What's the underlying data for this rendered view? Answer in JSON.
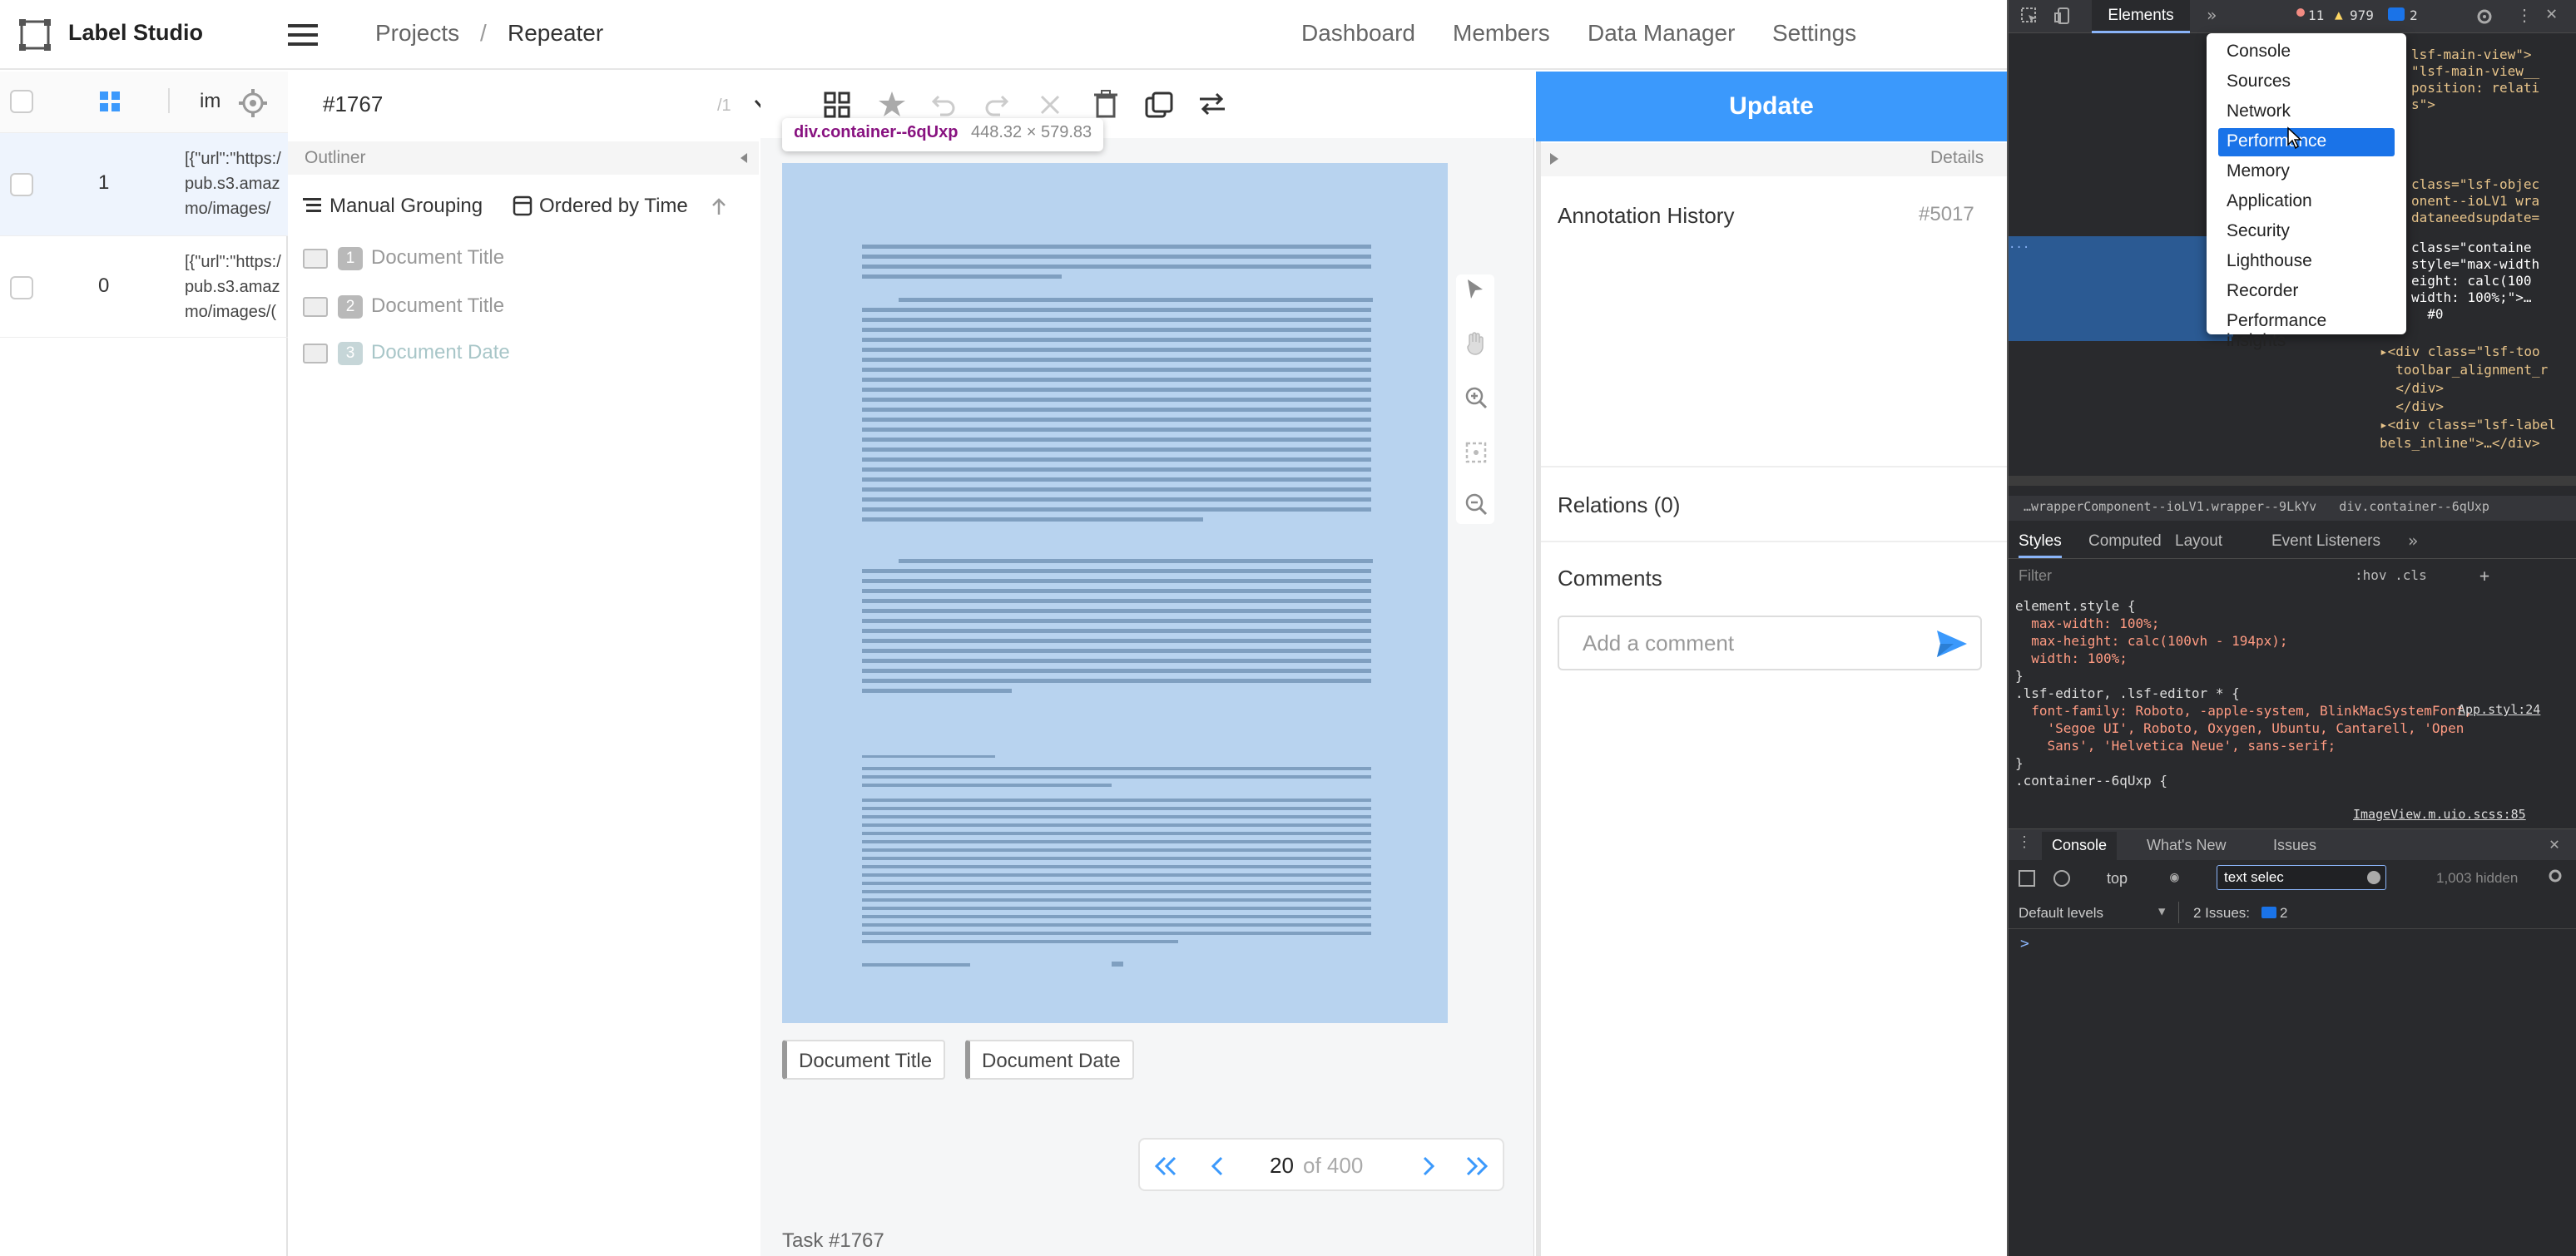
{
  "app": {
    "title": "Label Studio"
  },
  "breadcrumb": {
    "projects": "Projects",
    "separator": "/",
    "current": "Repeater"
  },
  "nav": {
    "dashboard": "Dashboard",
    "members": "Members",
    "data_manager": "Data Manager",
    "settings": "Settings"
  },
  "table": {
    "column_label": "im",
    "rows": [
      {
        "id": "1",
        "data": "[{\"url\":\"https:/\npub.s3.amaz\nmo/images/"
      },
      {
        "id": "0",
        "data": "[{\"url\":\"https:/\npub.s3.amaz\nmo/images/("
      }
    ]
  },
  "task": {
    "id": "#1767",
    "footer": "Task #1767"
  },
  "outliner": {
    "title": "Outliner",
    "grouping": "Manual Grouping",
    "ordering": "Ordered by Time",
    "regions": [
      {
        "num": "1",
        "label": "Document Title"
      },
      {
        "num": "2",
        "label": "Document Title"
      },
      {
        "num": "3",
        "label": "Document Date"
      }
    ]
  },
  "tooltip": {
    "selector": "div.container--6qUxp",
    "size": "448.32 × 579.83"
  },
  "labels": [
    "Document Title",
    "Document Date"
  ],
  "pager": {
    "current": "20",
    "of_text": "of 400"
  },
  "panel": {
    "update": "Update",
    "details": "Details",
    "annotation_history": "Annotation History",
    "annotation_id": "#5017",
    "relations": "Relations (0)",
    "comments": "Comments",
    "comment_placeholder": "Add a comment"
  },
  "devtools": {
    "tab_elements": "Elements",
    "errors": "11",
    "warnings": "979",
    "messages": "2",
    "menu": [
      "Console",
      "Sources",
      "Network",
      "Performance",
      "Memory",
      "Application",
      "Security",
      "Lighthouse",
      "Recorder",
      "Performance insights"
    ],
    "selected_menu": "Performance",
    "breadcrumb": "…wrapperComponent--ioLV1.wrapper--9LkYv   div.container--6qUxp",
    "styles_tabs": [
      "Styles",
      "Computed",
      "Layout",
      "Event Listeners"
    ],
    "filter_placeholder": "Filter",
    "hov_cls": ":hov  .cls",
    "css_lines": [
      "element.style {",
      "  max-width: 100%;",
      "  max-height: calc(100vh - 194px);",
      "  width: 100%;",
      "}",
      ".lsf-editor, .lsf-editor * {",
      "  font-family: Roboto, -apple-system, BlinkMacSystemFont,",
      "    'Segoe UI', Roboto, Oxygen, Ubuntu, Cantarell, 'Open",
      "    Sans', 'Helvetica Neue', sans-serif;",
      "}",
      ".container--6qUxp {"
    ],
    "css_source1": "App.styl:24",
    "css_source2": "ImageView.m.uio.scss:85",
    "html_lines": [
      "lsf-main-view\">",
      "\"lsf-main-view__",
      "position: relati",
      "s\">",
      "class=\"lsf-objec",
      "onent--ioLV1 wra",
      "dataneedsupdate=",
      "class=\"containe",
      "style=\"max-width",
      "eight: calc(100",
      "width: 100%;\">…",
      "  #0",
      "▸<div class=\"lsf-too",
      "  toolbar_alignment_r",
      "  </div>",
      "  </div>",
      "▸<div class=\"lsf-label",
      "bels_inline\">…</div>"
    ],
    "console_tabs": [
      "Console",
      "What's New",
      "Issues"
    ],
    "console_context": "top",
    "console_filter": "text selec",
    "console_hidden": "1,003 hidden",
    "default_levels": "Default levels",
    "issues": "2 Issues:",
    "issues_count": "2",
    "prompt": ">"
  }
}
